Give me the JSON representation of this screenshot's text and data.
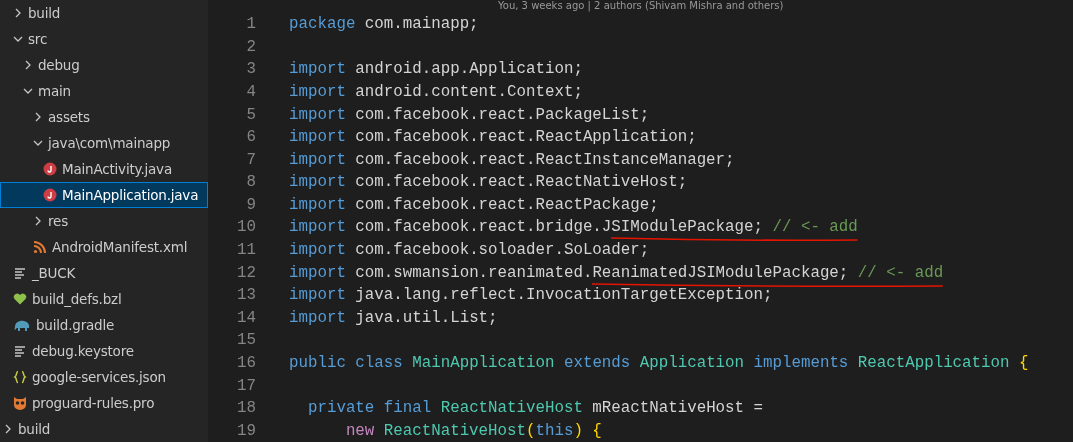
{
  "explorer": {
    "tree": [
      {
        "children": [
          {
            "label": "build",
            "kind": "folder",
            "expanded": false,
            "selected": false
          },
          {
            "label": "src",
            "kind": "folder",
            "expanded": true,
            "selected": false,
            "children": [
              {
                "label": "debug",
                "kind": "folder",
                "expanded": false,
                "selected": false
              },
              {
                "label": "main",
                "kind": "folder",
                "expanded": true,
                "selected": false,
                "children": [
                  {
                    "label": "assets",
                    "kind": "folder",
                    "expanded": false,
                    "selected": false
                  },
                  {
                    "label": "java\\com\\mainapp",
                    "kind": "folder",
                    "expanded": true,
                    "selected": false,
                    "children": [
                      {
                        "label": "MainActivity.java",
                        "kind": "java",
                        "selected": false
                      },
                      {
                        "label": "MainApplication.java",
                        "kind": "java",
                        "selected": true
                      }
                    ]
                  },
                  {
                    "label": "res",
                    "kind": "folder",
                    "expanded": false,
                    "selected": false
                  },
                  {
                    "label": "AndroidManifest.xml",
                    "kind": "xml",
                    "selected": false
                  }
                ]
              }
            ]
          },
          {
            "label": "_BUCK",
            "kind": "text",
            "selected": false
          },
          {
            "label": "build_defs.bzl",
            "kind": "bazel",
            "selected": false
          },
          {
            "label": "build.gradle",
            "kind": "gradle",
            "selected": false
          },
          {
            "label": "debug.keystore",
            "kind": "text",
            "selected": false
          },
          {
            "label": "google-services.json",
            "kind": "json",
            "selected": false
          },
          {
            "label": "proguard-rules.pro",
            "kind": "proguard",
            "selected": false
          }
        ]
      },
      {
        "label": "build",
        "kind": "folder",
        "expanded": false,
        "selected": false
      }
    ]
  },
  "editor": {
    "codelens": "You, 3 weeks ago | 2 authors (Shivam Mishra and others)",
    "lines": [
      {
        "number": "1",
        "tokens": [
          {
            "text": "package",
            "kind": "keyword"
          },
          {
            "text": " com.mainapp;",
            "kind": "plain"
          }
        ]
      },
      {
        "number": "2"
      },
      {
        "number": "3",
        "tokens": [
          {
            "text": "import",
            "kind": "keyword"
          },
          {
            "text": " android.app.Application;",
            "kind": "plain"
          }
        ]
      },
      {
        "number": "4",
        "tokens": [
          {
            "text": "import",
            "kind": "keyword"
          },
          {
            "text": " android.content.Context;",
            "kind": "plain"
          }
        ]
      },
      {
        "number": "5",
        "tokens": [
          {
            "text": "import",
            "kind": "keyword"
          },
          {
            "text": " com.facebook.react.PackageList;",
            "kind": "plain"
          }
        ]
      },
      {
        "number": "6",
        "tokens": [
          {
            "text": "import",
            "kind": "keyword"
          },
          {
            "text": " com.facebook.react.ReactApplication;",
            "kind": "plain"
          }
        ]
      },
      {
        "number": "7",
        "tokens": [
          {
            "text": "import",
            "kind": "keyword"
          },
          {
            "text": " com.facebook.react.ReactInstanceManager;",
            "kind": "plain"
          }
        ]
      },
      {
        "number": "8",
        "tokens": [
          {
            "text": "import",
            "kind": "keyword"
          },
          {
            "text": " com.facebook.react.ReactNativeHost;",
            "kind": "plain"
          }
        ]
      },
      {
        "number": "9",
        "tokens": [
          {
            "text": "import",
            "kind": "keyword"
          },
          {
            "text": " com.facebook.react.ReactPackage;",
            "kind": "plain"
          }
        ]
      },
      {
        "number": "10",
        "underlined": true,
        "tokens": [
          {
            "text": "import",
            "kind": "keyword"
          },
          {
            "text": " com.facebook.react.bridge.J",
            "kind": "plain"
          },
          {
            "text": "SIModulePackage; ",
            "kind": "plain"
          },
          {
            "text": "// <- add",
            "kind": "comment"
          }
        ]
      },
      {
        "number": "11",
        "tokens": [
          {
            "text": "import",
            "kind": "keyword"
          },
          {
            "text": " com.facebook.soloader.SoLoader;",
            "kind": "plain"
          }
        ]
      },
      {
        "number": "12",
        "underlined": true,
        "tokens": [
          {
            "text": "import",
            "kind": "keyword"
          },
          {
            "text": " com.swmansion.reanimated.",
            "kind": "plain"
          },
          {
            "text": "ReanimatedJSIModulePackage; ",
            "kind": "plain"
          },
          {
            "text": "// <- add",
            "kind": "comment"
          }
        ]
      },
      {
        "number": "13",
        "tokens": [
          {
            "text": "import",
            "kind": "keyword"
          },
          {
            "text": " java.lang.reflect.InvocationTargetException;",
            "kind": "plain"
          }
        ]
      },
      {
        "number": "14",
        "tokens": [
          {
            "text": "import",
            "kind": "keyword"
          },
          {
            "text": " java.util.List;",
            "kind": "plain"
          }
        ]
      },
      {
        "number": "15"
      },
      {
        "number": "16",
        "tokens": [
          {
            "text": "public class ",
            "kind": "keyword"
          },
          {
            "text": "MainApplication ",
            "kind": "type"
          },
          {
            "text": "extends ",
            "kind": "keyword"
          },
          {
            "text": "Application ",
            "kind": "type"
          },
          {
            "text": "implements ",
            "kind": "keyword"
          },
          {
            "text": "ReactApplication ",
            "kind": "type"
          },
          {
            "text": "{",
            "kind": "bracket"
          }
        ]
      },
      {
        "number": "17"
      },
      {
        "number": "18",
        "tokens": [
          {
            "text": "  private final ",
            "kind": "keyword"
          },
          {
            "text": "ReactNativeHost",
            "kind": "type"
          },
          {
            "text": " mReactNativeHost =",
            "kind": "plain"
          }
        ]
      },
      {
        "number": "19",
        "tokens": [
          {
            "text": "      new ",
            "kind": "control"
          },
          {
            "text": "ReactNativeHost",
            "kind": "type"
          },
          {
            "text": "(",
            "kind": "bracket"
          },
          {
            "text": "this",
            "kind": "keyword"
          },
          {
            "text": ") {",
            "kind": "bracket"
          }
        ]
      }
    ]
  }
}
